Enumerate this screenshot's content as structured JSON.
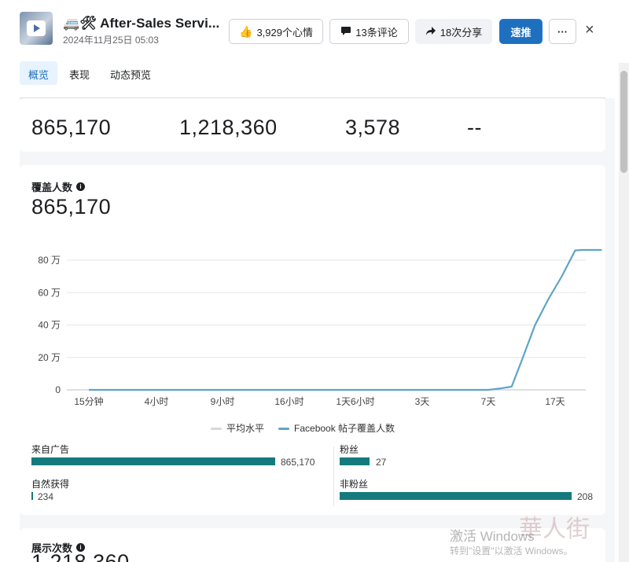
{
  "post": {
    "title": "🚐🛠 After-Sales Servi...",
    "date": "2024年11月25日 05:03"
  },
  "actions": {
    "reactions": "3,929个心情",
    "comments": "13条评论",
    "shares": "18次分享",
    "boost": "速推",
    "more": "···",
    "close": "×"
  },
  "tabs": [
    "概览",
    "表现",
    "动态预览"
  ],
  "summary": [
    "865,170",
    "1,218,360",
    "3,578",
    "--"
  ],
  "reach": {
    "title": "覆盖人数",
    "value": "865,170",
    "breakdown": {
      "ads_label": "来自广告",
      "ads_value": "865,170",
      "ads_fraction": 1.0,
      "organic_label": "自然获得",
      "organic_value": "234",
      "organic_fraction": 0.0003,
      "followers_label": "粉丝",
      "followers_value": "27",
      "followers_fraction": 0.13,
      "nonfollowers_label": "非粉丝",
      "nonfollowers_value": "208",
      "nonfollowers_fraction": 1.0
    }
  },
  "chart_data": {
    "type": "line",
    "x_ticks": [
      "15分钟",
      "4小时",
      "9小时",
      "16小时",
      "1天6小时",
      "3天",
      "7天",
      "17天"
    ],
    "y_ticks": [
      "0",
      "20 万",
      "40 万",
      "60 万",
      "80 万"
    ],
    "ylim": [
      0,
      860000
    ],
    "legend": [
      "平均水平",
      "Facebook 帖子覆盖人数"
    ],
    "legend_placement": "bottom",
    "grid": true,
    "series": [
      {
        "name": "Facebook 帖子覆盖人数",
        "color": "#5fa3c7",
        "x_index": [
          0,
          1,
          2,
          3,
          4,
          5,
          6,
          6.2,
          6.35,
          6.5,
          6.7,
          6.9,
          7.1,
          7.3,
          7.4,
          7.7
        ],
        "values": [
          0,
          0,
          0,
          0,
          0,
          0,
          0,
          10000,
          20000,
          180000,
          400000,
          560000,
          700000,
          860000,
          865000,
          865170
        ]
      },
      {
        "name": "平均水平",
        "color": "#d8d8d8",
        "x_index": [],
        "values": []
      }
    ]
  },
  "impressions": {
    "title": "展示次数",
    "value": "1,218,360"
  },
  "watermark": {
    "line1": "激活 Windows",
    "line2": "转到\"设置\"以激活 Windows。",
    "logo": "華人街"
  },
  "colors": {
    "accent": "#1f6fbf",
    "bar": "#157a7d",
    "line": "#5fa3c7"
  }
}
